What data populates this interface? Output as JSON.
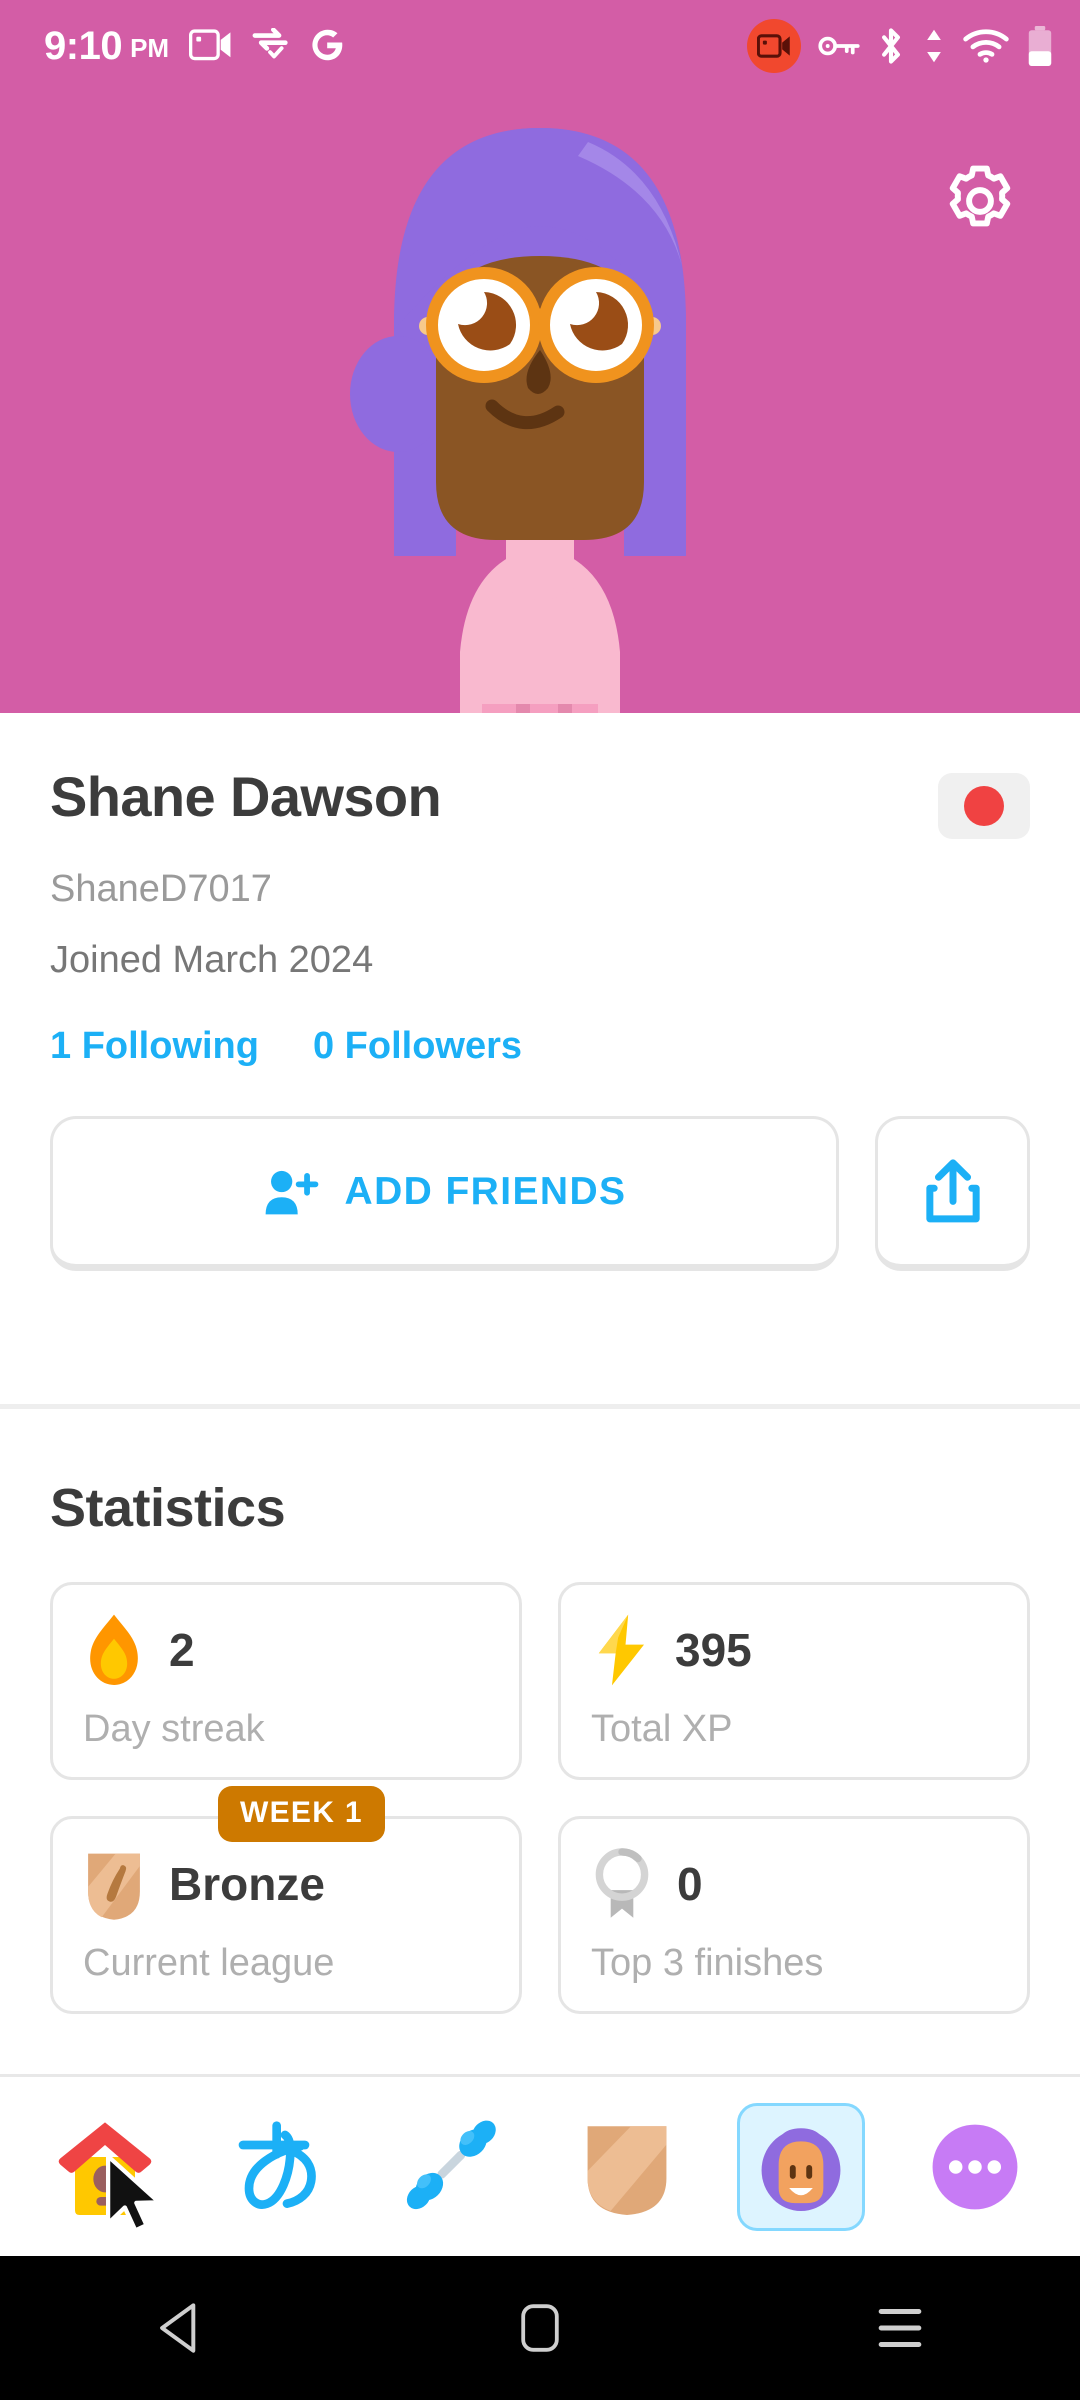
{
  "status_bar": {
    "time": "9:10",
    "ampm": "PM",
    "left_icons": [
      "video-camera-icon",
      "data-saver-icon",
      "google-icon"
    ],
    "right_icons": [
      "screen-record-icon",
      "vpn-key-icon",
      "bluetooth-icon",
      "data-transfer-icon",
      "wifi-icon",
      "battery-icon"
    ]
  },
  "header": {
    "background_color": "#d35da6",
    "settings_icon": "gear-icon",
    "avatar_alt": "duolingo-avatar-purple-hair-glasses"
  },
  "profile": {
    "display_name": "Shane Dawson",
    "username": "ShaneD7017",
    "joined": "Joined March 2024",
    "flag": "japan-flag",
    "following": "1 Following",
    "followers": "0 Followers",
    "add_friends_label": "ADD FRIENDS",
    "add_friends_icon": "person-add-icon",
    "share_icon": "share-icon",
    "accent_color": "#1cb0f6"
  },
  "statistics": {
    "title": "Statistics",
    "cards": [
      {
        "icon": "flame-icon",
        "value": "2",
        "label": "Day streak"
      },
      {
        "icon": "lightning-bolt-icon",
        "value": "395",
        "label": "Total XP"
      },
      {
        "icon": "bronze-shield-icon",
        "value": "Bronze",
        "label": "Current league",
        "badge": "WEEK 1",
        "badge_color": "#cd7900"
      },
      {
        "icon": "medal-icon",
        "value": "0",
        "label": "Top 3 finishes"
      }
    ]
  },
  "tab_bar": {
    "tabs": [
      {
        "name": "learn",
        "icon": "birdhouse-icon",
        "active": false
      },
      {
        "name": "alphabet",
        "icon": "hiragana-a-icon",
        "active": false
      },
      {
        "name": "practice",
        "icon": "dumbbell-icon",
        "active": false
      },
      {
        "name": "leagues",
        "icon": "bronze-shield-icon",
        "active": false
      },
      {
        "name": "profile",
        "icon": "avatar-face-icon",
        "active": true
      },
      {
        "name": "more",
        "icon": "more-dots-icon",
        "active": false
      }
    ],
    "active_highlight": "#ddf4ff"
  },
  "android_nav": {
    "buttons": [
      "back-icon",
      "home-icon",
      "recents-icon"
    ]
  }
}
